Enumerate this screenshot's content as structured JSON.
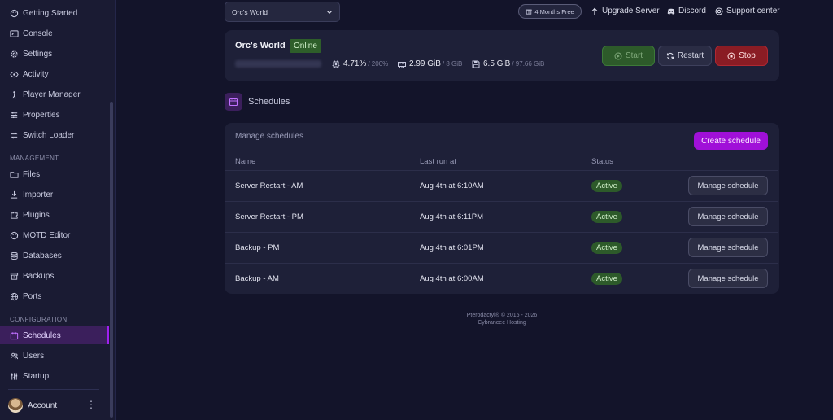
{
  "sidebar": {
    "items_top": [
      {
        "label": "Getting Started",
        "icon": "palette-icon"
      },
      {
        "label": "Console",
        "icon": "terminal-icon"
      },
      {
        "label": "Settings",
        "icon": "gear-icon"
      },
      {
        "label": "Activity",
        "icon": "eye-icon"
      },
      {
        "label": "Player Manager",
        "icon": "person-icon"
      },
      {
        "label": "Properties",
        "icon": "sliders-icon"
      },
      {
        "label": "Switch Loader",
        "icon": "swap-icon"
      }
    ],
    "management_label": "MANAGEMENT",
    "items_management": [
      {
        "label": "Files",
        "icon": "folder-icon"
      },
      {
        "label": "Importer",
        "icon": "download-icon"
      },
      {
        "label": "Plugins",
        "icon": "puzzle-icon"
      },
      {
        "label": "MOTD Editor",
        "icon": "palette-icon"
      },
      {
        "label": "Databases",
        "icon": "database-icon"
      },
      {
        "label": "Backups",
        "icon": "archive-icon"
      },
      {
        "label": "Ports",
        "icon": "globe-icon"
      }
    ],
    "configuration_label": "CONFIGURATION",
    "items_configuration": [
      {
        "label": "Schedules",
        "icon": "calendar-icon",
        "active": true
      },
      {
        "label": "Users",
        "icon": "users-icon"
      },
      {
        "label": "Startup",
        "icon": "sliders-icon"
      }
    ],
    "account_label": "Account",
    "kebab": "⋮"
  },
  "topbar": {
    "server_select": "Orc's World",
    "free_badge": "4 Months Free",
    "upgrade": "Upgrade Server",
    "discord": "Discord",
    "support": "Support center"
  },
  "server": {
    "name": "Orc's World",
    "status": "Online",
    "cpu": "4.71%",
    "cpu_limit": "/ 200%",
    "memory": "2.99 GiB",
    "memory_limit": "/ 8 GiB",
    "disk": "6.5 GiB",
    "disk_limit": "/ 97.66 GiB",
    "start_label": "Start",
    "restart_label": "Restart",
    "stop_label": "Stop"
  },
  "schedules": {
    "title": "Schedules",
    "manage_label": "Manage schedules",
    "create_label": "Create schedule",
    "columns": [
      "Name",
      "Last run at",
      "Status"
    ],
    "rows": [
      {
        "name": "Server Restart - AM",
        "last_run": "Aug 4th at 6:10AM",
        "status": "Active",
        "action": "Manage schedule"
      },
      {
        "name": "Server Restart - PM",
        "last_run": "Aug 4th at 6:11PM",
        "status": "Active",
        "action": "Manage schedule"
      },
      {
        "name": "Backup - PM",
        "last_run": "Aug 4th at 6:01PM",
        "status": "Active",
        "action": "Manage schedule"
      },
      {
        "name": "Backup - AM",
        "last_run": "Aug 4th at 6:00AM",
        "status": "Active",
        "action": "Manage schedule"
      }
    ]
  },
  "footer": {
    "line1": "Pterodactyl® © 2015 - 2026",
    "line2": "Cybrancee Hosting"
  },
  "colors": {
    "accent": "#a010d8",
    "active_green": "#2d5a2a",
    "stop_red": "#8a1c24"
  }
}
